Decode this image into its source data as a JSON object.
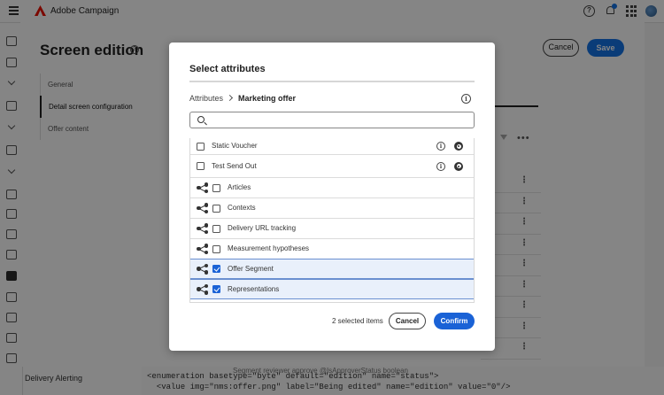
{
  "topbar": {
    "app_name": "Adobe Campaign"
  },
  "panel": {
    "title": "Screen edition",
    "cancel_label": "Cancel",
    "save_label": "Save",
    "nav": [
      "General",
      "Detail screen configuration",
      "Offer content"
    ],
    "row_more": "⋮",
    "top_more": "•••"
  },
  "background": {
    "alert_label": "Delivery Alerting",
    "code_line_1": "<enumeration basetype=\"byte\" default=\"edition\" name=\"status\">",
    "code_line_2": "  <value img=\"nms:offer.png\" label=\"Being edited\" name=\"edition\" value=\"0\"/>",
    "ghost_row": "Segment reviewer approve        @IsApproverStatus              boolean"
  },
  "dialog": {
    "title": "Select attributes",
    "breadcrumb": {
      "root": "Attributes",
      "current": "Marketing offer"
    },
    "search": {
      "value": "",
      "placeholder": ""
    },
    "rows": [
      {
        "label": "Static Voucher",
        "type": "field",
        "checked": false
      },
      {
        "label": "Test Send Out",
        "type": "field",
        "checked": false
      },
      {
        "label": "Articles",
        "type": "link",
        "checked": false
      },
      {
        "label": "Contexts",
        "type": "link",
        "checked": false
      },
      {
        "label": "Delivery URL tracking",
        "type": "link",
        "checked": false
      },
      {
        "label": "Measurement hypotheses",
        "type": "link",
        "checked": false
      },
      {
        "label": "Offer Segment",
        "type": "link",
        "checked": true
      },
      {
        "label": "Representations",
        "type": "link",
        "checked": true
      }
    ],
    "selected_count": "2 selected items",
    "cancel_label": "Cancel",
    "confirm_label": "Confirm"
  },
  "colors": {
    "accent": "#1a62d6",
    "selected_row": "#e9f0fb",
    "brand": "#eb1000"
  }
}
